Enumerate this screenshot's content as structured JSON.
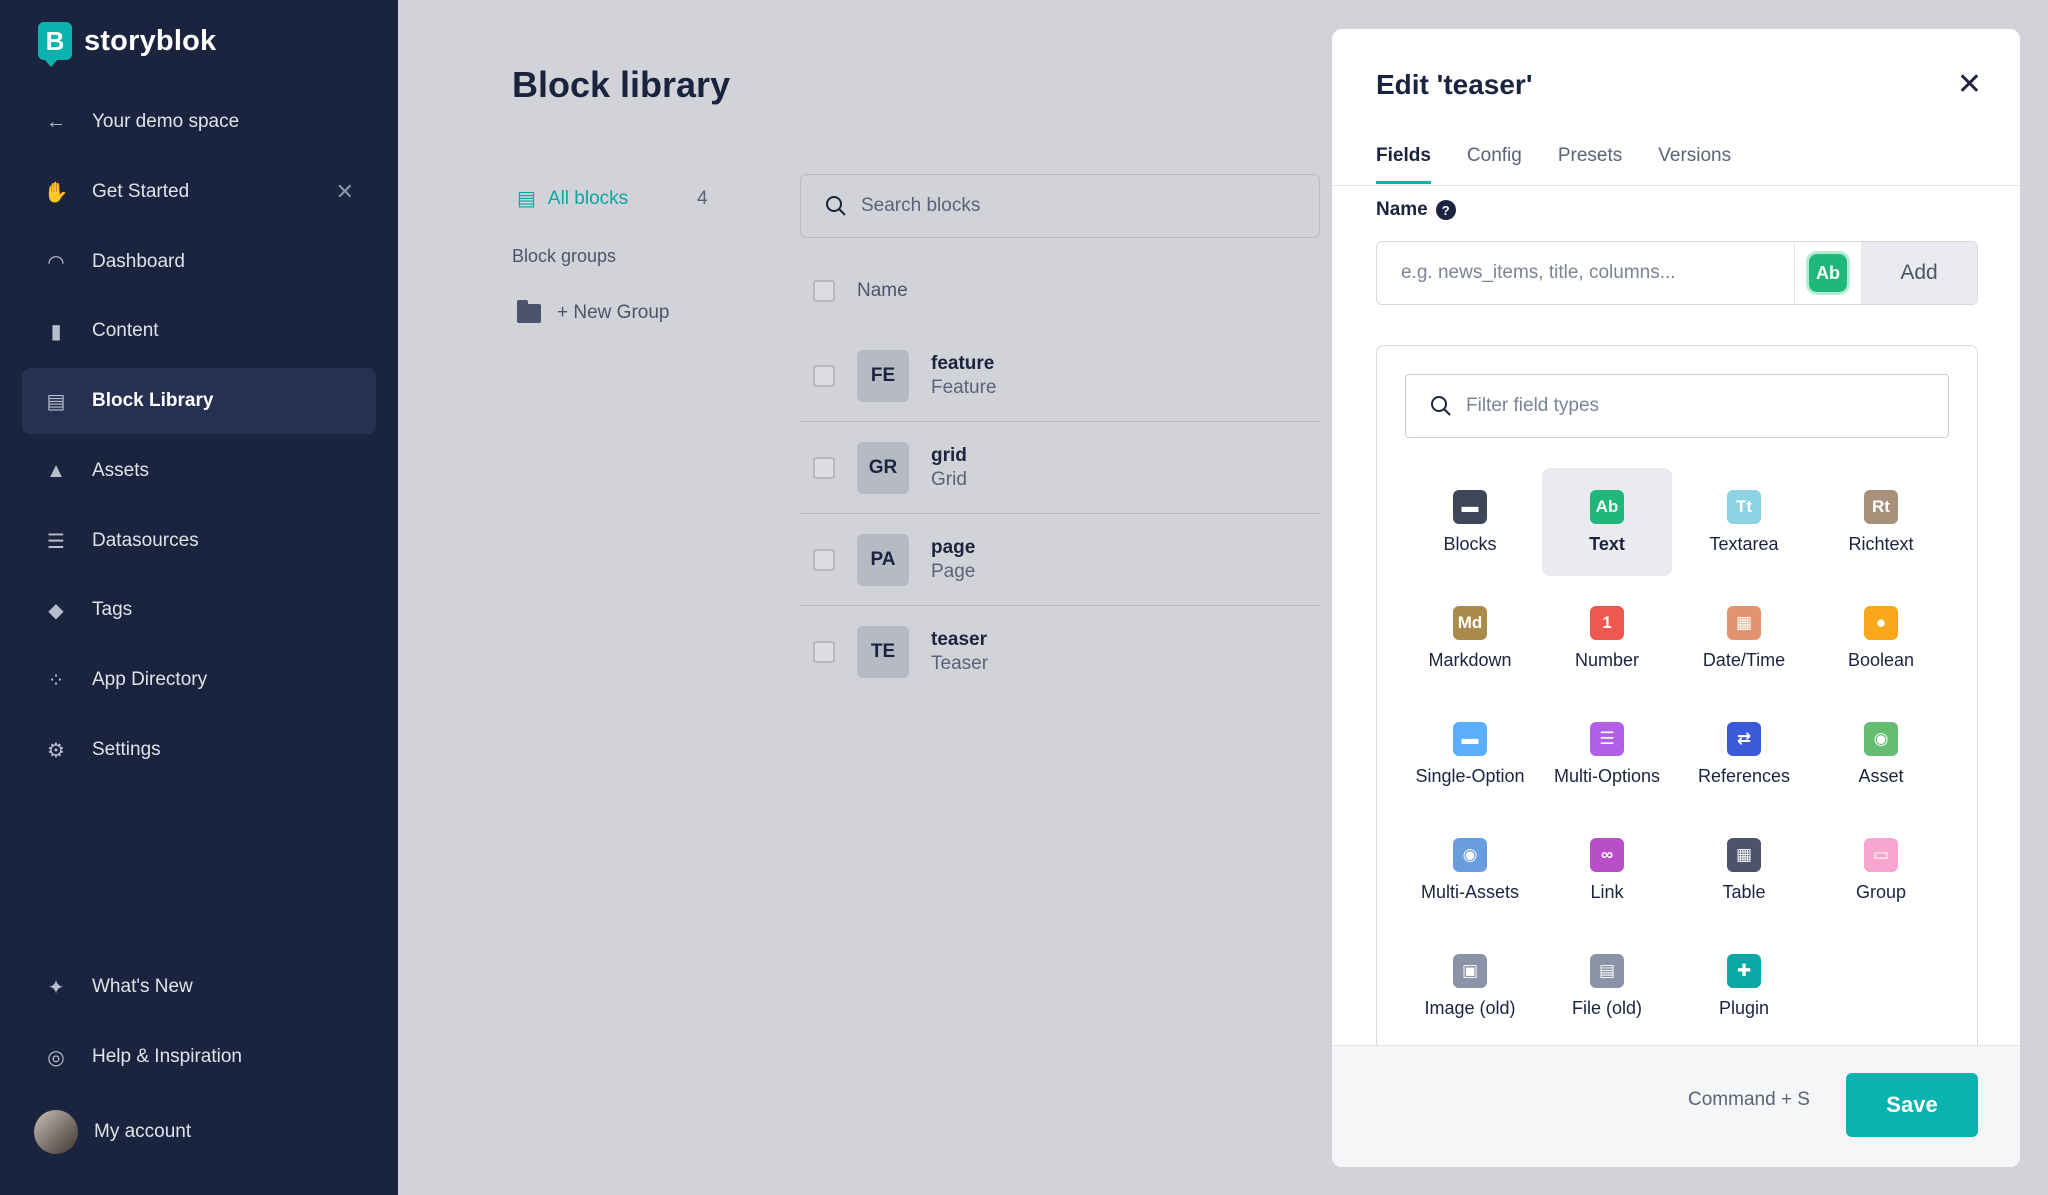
{
  "brand": {
    "name": "storyblok",
    "mark": "B"
  },
  "sidebar": {
    "items": [
      {
        "label": "Your demo space",
        "icon": "arrow-left-icon"
      },
      {
        "label": "Get Started",
        "icon": "hand-icon"
      },
      {
        "label": "Dashboard",
        "icon": "dashboard-icon"
      },
      {
        "label": "Content",
        "icon": "content-icon"
      },
      {
        "label": "Block Library",
        "icon": "block-library-icon",
        "active": true
      },
      {
        "label": "Assets",
        "icon": "assets-icon"
      },
      {
        "label": "Datasources",
        "icon": "datasources-icon"
      },
      {
        "label": "Tags",
        "icon": "tags-icon"
      },
      {
        "label": "App Directory",
        "icon": "app-directory-icon"
      },
      {
        "label": "Settings",
        "icon": "gear-icon"
      }
    ],
    "bottom": [
      {
        "label": "What's New",
        "icon": "magic-wand-icon"
      },
      {
        "label": "Help & Inspiration",
        "icon": "lifebuoy-icon"
      },
      {
        "label": "My account",
        "icon": "avatar"
      }
    ]
  },
  "main": {
    "title": "Block library",
    "all_blocks": {
      "label": "All blocks",
      "count": "4"
    },
    "groups_label": "Block groups",
    "new_group": "+ New Group",
    "search_placeholder": "Search blocks",
    "column_name": "Name",
    "rows": [
      {
        "badge": "FE",
        "name": "feature",
        "display": "Feature"
      },
      {
        "badge": "GR",
        "name": "grid",
        "display": "Grid"
      },
      {
        "badge": "PA",
        "name": "page",
        "display": "Page"
      },
      {
        "badge": "TE",
        "name": "teaser",
        "display": "Teaser"
      }
    ]
  },
  "panel": {
    "title": "Edit 'teaser'",
    "tabs": [
      "Fields",
      "Config",
      "Presets",
      "Versions"
    ],
    "active_tab": "Fields",
    "name_label": "Name",
    "name_placeholder": "e.g. news_items, title, columns...",
    "type_button": "Ab",
    "add_label": "Add",
    "filter_placeholder": "Filter field types",
    "field_types": [
      {
        "label": "Blocks",
        "glyph": "▬",
        "color": "#3f4658"
      },
      {
        "label": "Text",
        "glyph": "Ab",
        "color": "#1fb87a",
        "selected": true
      },
      {
        "label": "Textarea",
        "glyph": "Tt",
        "color": "#8ed3e3"
      },
      {
        "label": "Richtext",
        "glyph": "Rt",
        "color": "#a8917a"
      },
      {
        "label": "Markdown",
        "glyph": "Md",
        "color": "#ab8b4a"
      },
      {
        "label": "Number",
        "glyph": "1",
        "color": "#f0574f"
      },
      {
        "label": "Date/Time",
        "glyph": "▦",
        "color": "#e3936e"
      },
      {
        "label": "Boolean",
        "glyph": "●",
        "color": "#f8a81a"
      },
      {
        "label": "Single-Option",
        "glyph": "▬",
        "color": "#5aaefc"
      },
      {
        "label": "Multi-Options",
        "glyph": "☰",
        "color": "#b15fe6"
      },
      {
        "label": "References",
        "glyph": "⇄",
        "color": "#3b5ad9"
      },
      {
        "label": "Asset",
        "glyph": "◉",
        "color": "#65bd72"
      },
      {
        "label": "Multi-Assets",
        "glyph": "◉",
        "color": "#6a9ddd"
      },
      {
        "label": "Link",
        "glyph": "∞",
        "color": "#b84fc9"
      },
      {
        "label": "Table",
        "glyph": "▦",
        "color": "#4b546a"
      },
      {
        "label": "Group",
        "glyph": "▭",
        "color": "#f7a6cf"
      },
      {
        "label": "Image (old)",
        "glyph": "▣",
        "color": "#8b93a7"
      },
      {
        "label": "File (old)",
        "glyph": "▤",
        "color": "#8b93a7"
      },
      {
        "label": "Plugin",
        "glyph": "✚",
        "color": "#0aa8a4"
      }
    ],
    "shortcut": "Command + S",
    "save_label": "Save"
  }
}
